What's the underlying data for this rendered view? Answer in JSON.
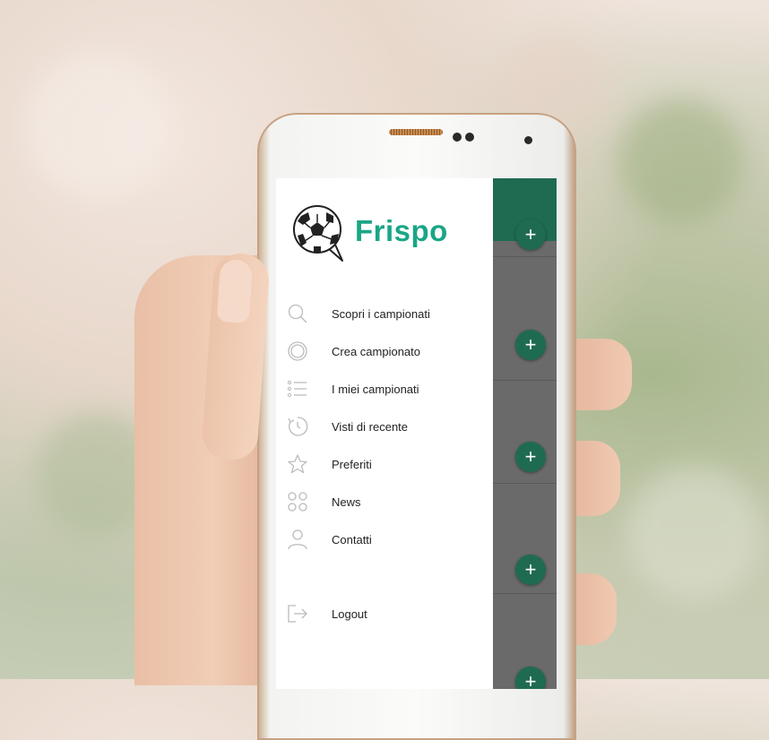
{
  "app": {
    "brand": "Frispo"
  },
  "menu": [
    {
      "label": "Scopri i campionati",
      "icon": "search-icon"
    },
    {
      "label": "Crea campionato",
      "icon": "create-circle-icon"
    },
    {
      "label": "I miei campionati",
      "icon": "list-icon"
    },
    {
      "label": "Visti di recente",
      "icon": "history-icon"
    },
    {
      "label": "Preferiti",
      "icon": "star-icon"
    },
    {
      "label": "News",
      "icon": "news-grid-icon"
    },
    {
      "label": "Contatti",
      "icon": "person-icon"
    }
  ],
  "logout": {
    "label": "Logout",
    "icon": "logout-icon"
  },
  "add_buttons": {
    "symbol": "+"
  },
  "colors": {
    "brand": "#1aa685",
    "header": "#1f6b52"
  }
}
